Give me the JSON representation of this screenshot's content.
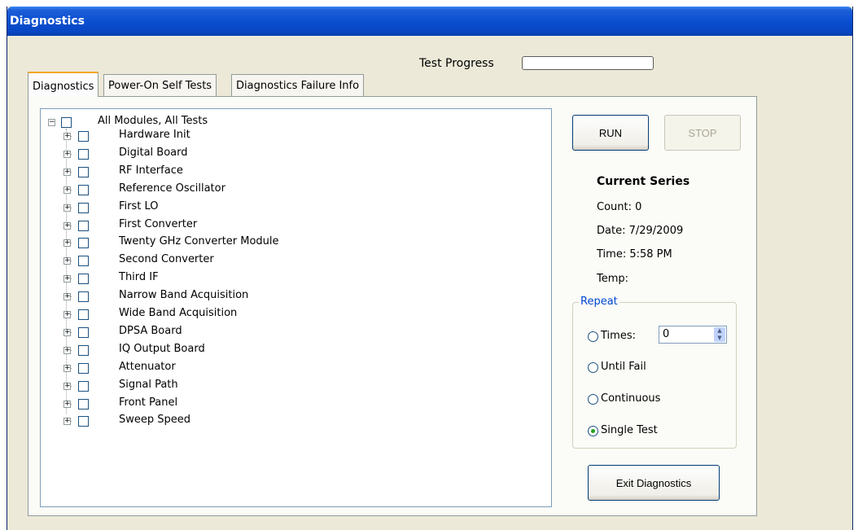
{
  "window": {
    "title": "Diagnostics"
  },
  "progress": {
    "label": "Test Progress",
    "value": 0
  },
  "tabs": [
    {
      "label": "Diagnostics",
      "active": true
    },
    {
      "label": "Power-On Self Tests",
      "active": false
    },
    {
      "label": "Diagnostics Failure Info",
      "active": false
    }
  ],
  "tree": {
    "root": "All Modules, All Tests",
    "items": [
      "Hardware Init",
      "Digital Board",
      "RF Interface",
      "Reference Oscillator",
      "First LO",
      "First Converter",
      "Twenty GHz Converter Module",
      "Second Converter",
      "Third IF",
      "Narrow Band Acquisition",
      "Wide Band Acquisition",
      "DPSA Board",
      "IQ Output Board",
      "Attenuator",
      "Signal Path",
      "Front Panel",
      "Sweep Speed"
    ]
  },
  "buttons": {
    "run": "RUN",
    "stop": "STOP",
    "exit": "Exit Diagnostics"
  },
  "series": {
    "heading": "Current Series",
    "count": "Count: 0",
    "date": "Date:  7/29/2009",
    "time": "Time:  5:58 PM",
    "temp": "Temp:"
  },
  "repeat": {
    "title": "Repeat",
    "times_label": "Times:",
    "times_value": "0",
    "until_fail": "Until Fail",
    "continuous": "Continuous",
    "single_test": "Single Test",
    "selected": "single_test"
  },
  "colors": {
    "titlebar": "#0846c4",
    "tab_highlight": "#f5a623",
    "group_title": "#0046d5",
    "radio_dot": "#21a121"
  }
}
